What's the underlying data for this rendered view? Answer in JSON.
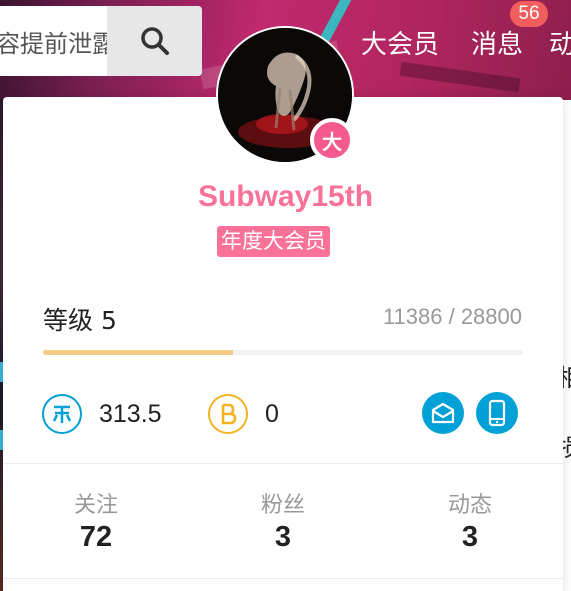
{
  "header": {
    "search_text": "容提前泄露",
    "links": [
      {
        "label": "大会员"
      },
      {
        "label": "消息"
      },
      {
        "label": "动"
      }
    ],
    "message_badge": "56"
  },
  "profile": {
    "username": "Subway15th",
    "vip_badge": "大",
    "vip_tag": "年度大会员",
    "level_label": "等级 5",
    "exp_text": "11386 / 28800",
    "exp_progress": 0.395
  },
  "wallet": {
    "coins": "313.5",
    "bcoins": "0"
  },
  "stats": [
    {
      "label": "关注",
      "value": "72"
    },
    {
      "label": "粉丝",
      "value": "3"
    },
    {
      "label": "动态",
      "value": "3"
    }
  ],
  "side_text": [
    "相",
    "损"
  ],
  "colors": {
    "accent_pink": "#fb7299",
    "vip_pink": "#f45a8d",
    "blue": "#00a1d6",
    "gold": "#f3cb85",
    "badge_red": "#f25d5d"
  }
}
